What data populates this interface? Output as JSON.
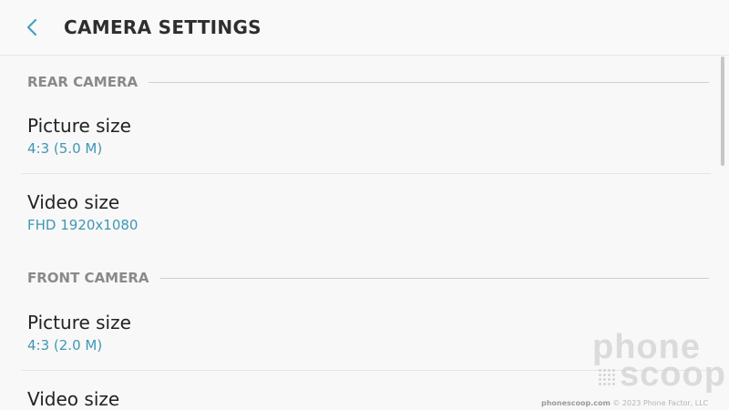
{
  "header": {
    "title": "CAMERA SETTINGS",
    "back_icon": "chevron-left-icon"
  },
  "colors": {
    "accent": "#3f97b3",
    "section_label": "#8a8a8a",
    "title": "#2e2e2e"
  },
  "sections": [
    {
      "label": "REAR CAMERA",
      "items": [
        {
          "title": "Picture size",
          "value": "4:3 (5.0 M)"
        },
        {
          "title": "Video size",
          "value": "FHD 1920x1080"
        }
      ]
    },
    {
      "label": "FRONT CAMERA",
      "items": [
        {
          "title": "Picture size",
          "value": "4:3 (2.0 M)"
        },
        {
          "title": "Video size",
          "value": ""
        }
      ]
    }
  ],
  "watermark": {
    "line1": "phone",
    "line2": "scoop",
    "site": "phonescoop.com",
    "copyright": "© 2023 Phone Factor, LLC"
  }
}
